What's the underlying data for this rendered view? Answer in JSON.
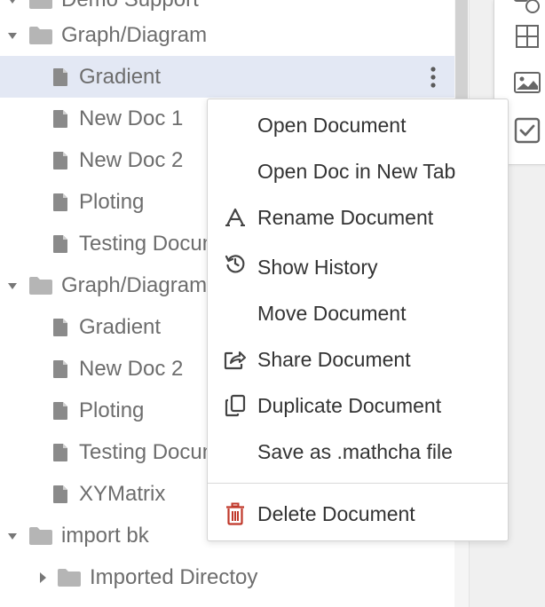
{
  "tree": {
    "rows": [
      {
        "label": "Demo Support",
        "type": "folder",
        "depth": 0,
        "expanded": true
      },
      {
        "label": "Graph/Diagram",
        "type": "folder",
        "depth": 0,
        "expanded": true
      },
      {
        "label": "Gradient",
        "type": "doc",
        "depth": 1,
        "selected": true
      },
      {
        "label": "New Doc 1",
        "type": "doc",
        "depth": 1
      },
      {
        "label": "New Doc 2",
        "type": "doc",
        "depth": 1
      },
      {
        "label": "Ploting",
        "type": "doc",
        "depth": 1
      },
      {
        "label": "Testing Document",
        "type": "doc",
        "depth": 1
      },
      {
        "label": "Graph/Diagram",
        "type": "folder",
        "depth": 0,
        "expanded": true
      },
      {
        "label": "Gradient",
        "type": "doc",
        "depth": 1
      },
      {
        "label": "New Doc 2",
        "type": "doc",
        "depth": 1
      },
      {
        "label": "Ploting",
        "type": "doc",
        "depth": 1
      },
      {
        "label": "Testing Document",
        "type": "doc",
        "depth": 1
      },
      {
        "label": "XYMatrix",
        "type": "doc",
        "depth": 1
      },
      {
        "label": "import bk",
        "type": "folder",
        "depth": 0,
        "expanded": true
      },
      {
        "label": "Imported Directoy",
        "type": "folder",
        "depth": 1,
        "expanded": false
      }
    ]
  },
  "context_menu": {
    "items": [
      {
        "label": "Open Document",
        "icon": ""
      },
      {
        "label": "Open Doc in New Tab",
        "icon": ""
      },
      {
        "label": "Rename Document",
        "icon": "rename-icon"
      },
      {
        "label": "Show History",
        "icon": "history-icon"
      },
      {
        "label": "Move Document",
        "icon": ""
      },
      {
        "label": "Share Document",
        "icon": "share-icon"
      },
      {
        "label": "Duplicate Document",
        "icon": "duplicate-icon"
      },
      {
        "label": "Save as .mathcha file",
        "icon": ""
      }
    ],
    "danger_item": {
      "label": "Delete Document",
      "icon": "trash-icon"
    }
  },
  "toolbar": {
    "tools": [
      "shapes-icon",
      "table-icon",
      "image-icon",
      "checkbox-icon"
    ]
  },
  "colors": {
    "selected_row": "#e3e8f4",
    "tree_text": "#6d6d6d",
    "tree_icon": "#8a8a8a",
    "menu_text": "#333333",
    "danger": "#c0392b"
  }
}
